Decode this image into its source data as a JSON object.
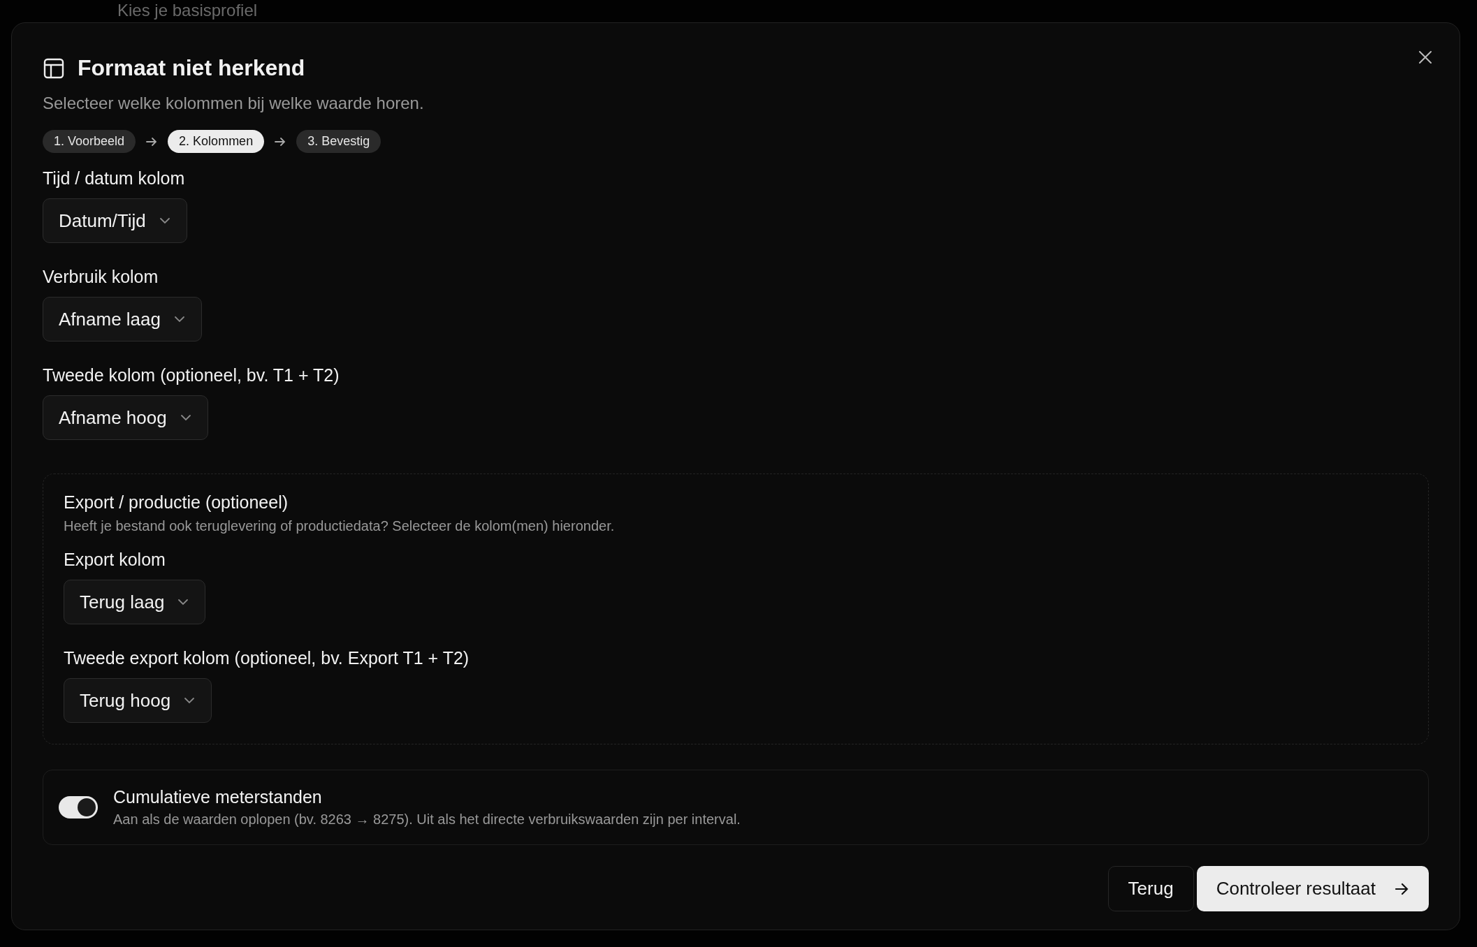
{
  "background_page": {
    "title": "Kies je basisprofiel"
  },
  "dialog": {
    "title": "Formaat niet herkend",
    "subtitle": "Selecteer welke kolommen bij welke waarde horen.",
    "steps": [
      {
        "label": "1. Voorbeeld",
        "selected": false
      },
      {
        "label": "2. Kolommen",
        "selected": true
      },
      {
        "label": "3. Bevestig",
        "selected": false
      }
    ],
    "fields": [
      {
        "label": "Tijd / datum kolom",
        "value": "Datum/Tijd"
      },
      {
        "label": "Verbruik kolom",
        "value": "Afname laag"
      },
      {
        "label": "Tweede kolom (optioneel, bv. T1 + T2)",
        "value": "Afname hoog"
      }
    ],
    "export_section": {
      "title": "Export / productie (optioneel)",
      "description": "Heeft je bestand ook teruglevering of productiedata? Selecteer de kolom(men) hieronder.",
      "fields": [
        {
          "label": "Export kolom",
          "value": "Terug laag"
        },
        {
          "label": "Tweede export kolom (optioneel, bv. Export T1 + T2)",
          "value": "Terug hoog"
        }
      ]
    },
    "cumulative_toggle": {
      "label": "Cumulatieve meterstanden",
      "description": "Aan als de waarden oplopen (bv. 8263 → 8275). Uit als het directe verbruikswaarden zijn per interval.",
      "on": true
    },
    "buttons": [
      {
        "label": "Terug",
        "kind": "secondary"
      },
      {
        "label": "Controleer resultaat",
        "kind": "primary"
      }
    ]
  }
}
